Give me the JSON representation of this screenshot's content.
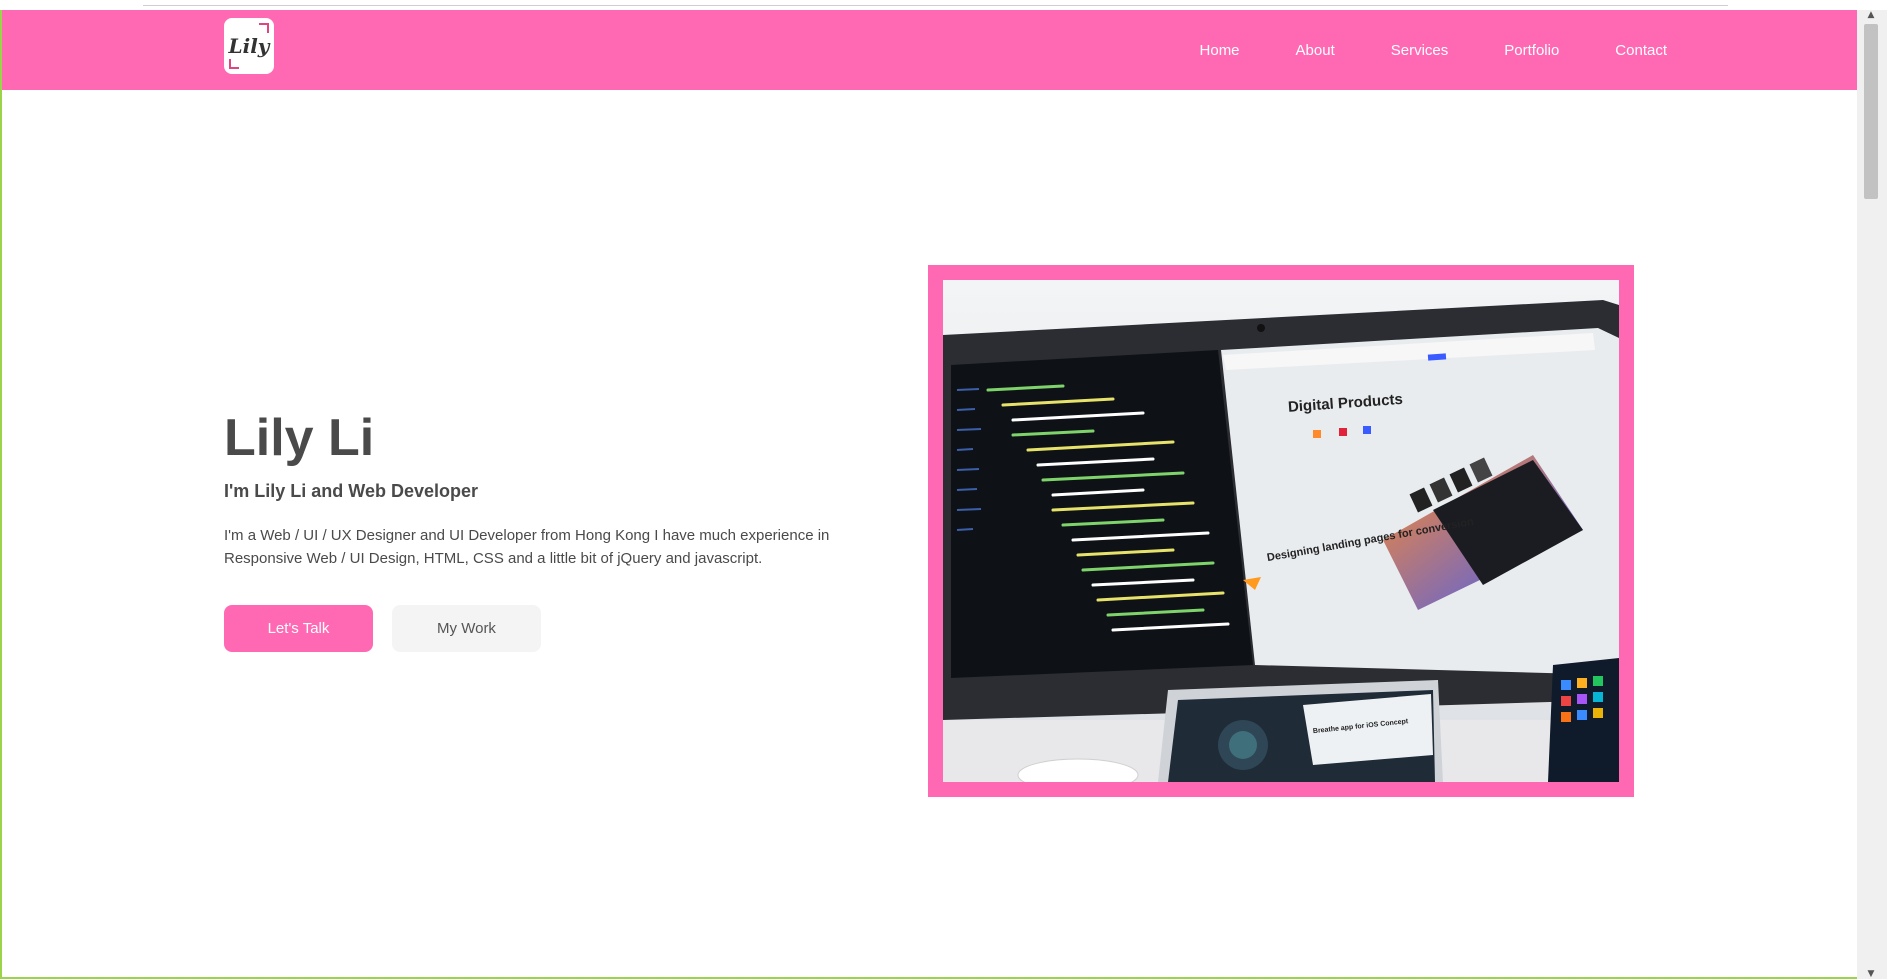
{
  "brand": {
    "logo_text": "Lily",
    "accent_color": "#ff69b4"
  },
  "nav": {
    "items": [
      {
        "label": "Home"
      },
      {
        "label": "About"
      },
      {
        "label": "Services"
      },
      {
        "label": "Portfolio"
      },
      {
        "label": "Contact"
      }
    ]
  },
  "hero": {
    "title": "Lily Li",
    "subtitle": "I'm Lily Li and Web Developer",
    "description": "I'm a Web / UI / UX Designer and UI Developer from Hong Kong I have much experience in Responsive Web / UI Design, HTML, CSS and a little bit of jQuery and javascript.",
    "primary_button": "Let's Talk",
    "secondary_button": "My Work",
    "image": {
      "screen_heading": "Digital Products",
      "card_heading": "Designing landing pages for conversion",
      "tablet_heading": "Breathe app for iOS Concept"
    }
  },
  "icons": {
    "scroll_up": "chevron-up-icon",
    "scroll_down": "chevron-down-icon"
  }
}
